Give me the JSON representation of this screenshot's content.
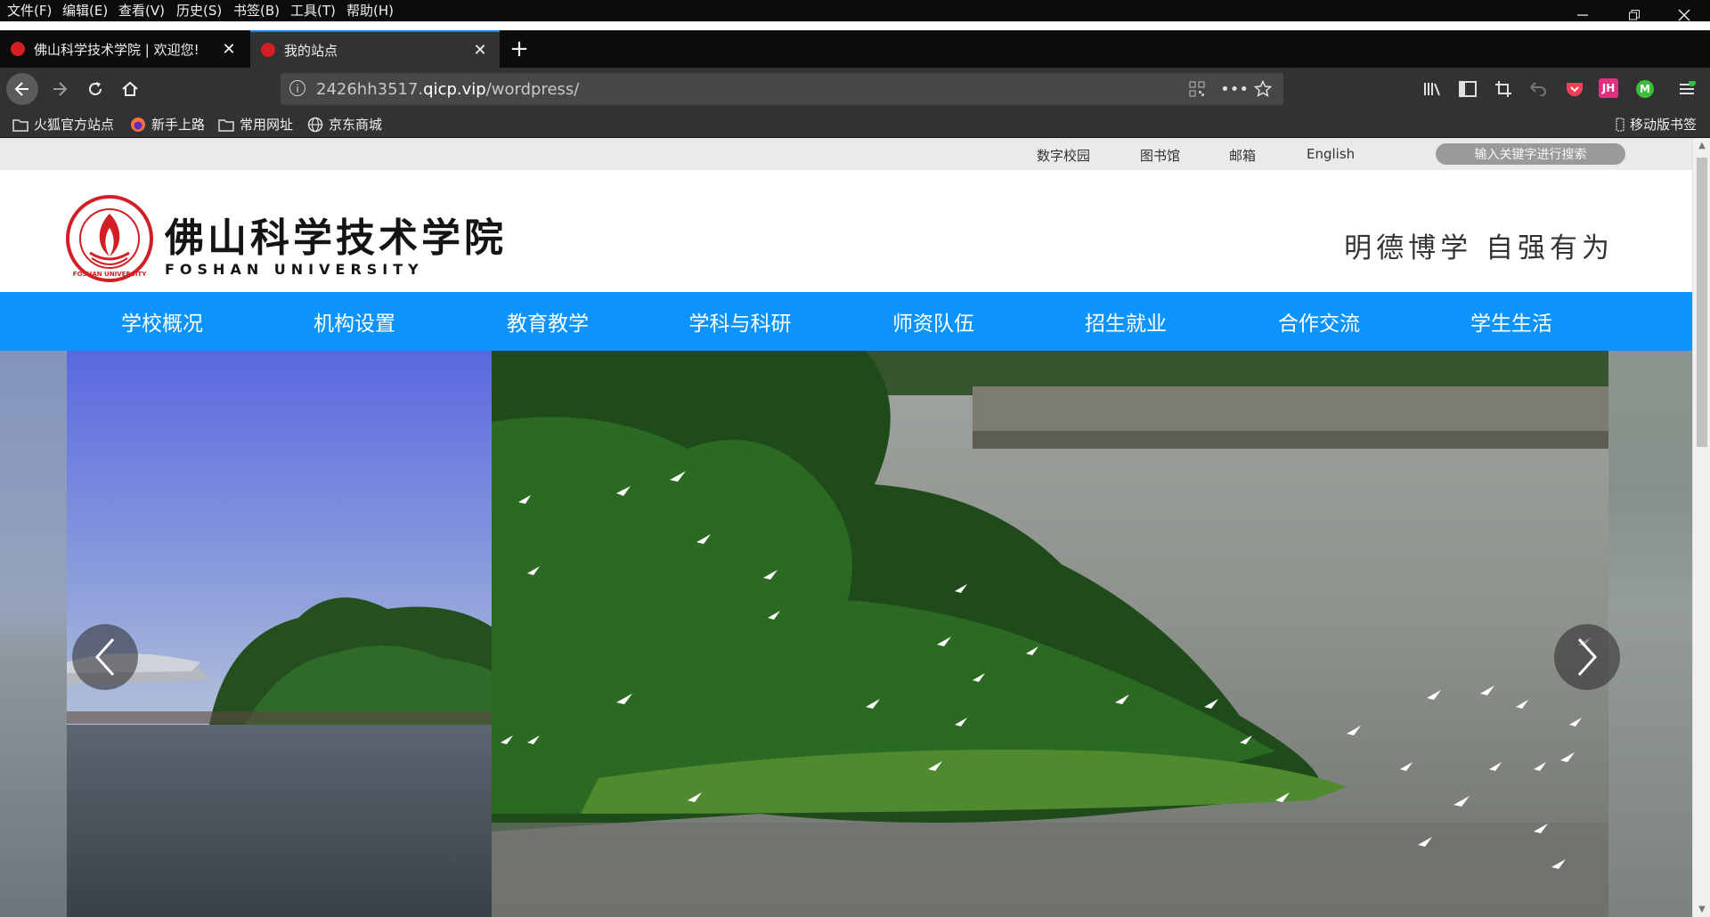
{
  "browser": {
    "menu": [
      "文件(F)",
      "编辑(E)",
      "查看(V)",
      "历史(S)",
      "书签(B)",
      "工具(T)",
      "帮助(H)"
    ],
    "tabs": [
      {
        "title": "佛山科学技术学院 | 欢迎您!",
        "active": false
      },
      {
        "title": "我的站点",
        "active": true
      }
    ],
    "url": {
      "prefix": "2426hh3517.",
      "domain": "qicp.vip",
      "path": "/wordpress/"
    },
    "bookmarks": [
      "火狐官方站点",
      "新手上路",
      "常用网址",
      "京东商城"
    ],
    "mobile_bookmarks": "移动版书签",
    "icons": {
      "back": "back-arrow-icon",
      "forward": "forward-arrow-icon",
      "reload": "reload-icon",
      "home": "home-icon",
      "info": "info-icon",
      "qr": "qr-code-icon",
      "more": "more-dots-icon",
      "star": "bookmark-star-icon",
      "library": "library-icon",
      "sidebar": "sidebar-icon",
      "screenshot": "screenshot-icon",
      "undo": "undo-icon",
      "pocket": "pocket-icon",
      "ext_jh": "jh-extension-icon",
      "ext_m": "m-extension-icon",
      "menu": "hamburger-menu-icon"
    },
    "ext_jh_label": "JH",
    "ext_m_label": "M",
    "accent": "#0a84ff"
  },
  "site": {
    "toplinks": [
      "数字校园",
      "图书馆",
      "邮箱",
      "English"
    ],
    "search_placeholder": "输入关键字进行搜索",
    "logo": {
      "name_cn": "佛山科学技术学院",
      "name_en": "FOSHAN UNIVERSITY",
      "seal_text": "FOSHAN UNIVERSITY"
    },
    "motto": "明德博学 自强有为",
    "nav": [
      "学校概况",
      "机构设置",
      "教育教学",
      "学科与科研",
      "师资队伍",
      "招生就业",
      "合作交流",
      "学生生活"
    ],
    "nav_color": "#0d94fc",
    "brand_red": "#d21f26"
  }
}
